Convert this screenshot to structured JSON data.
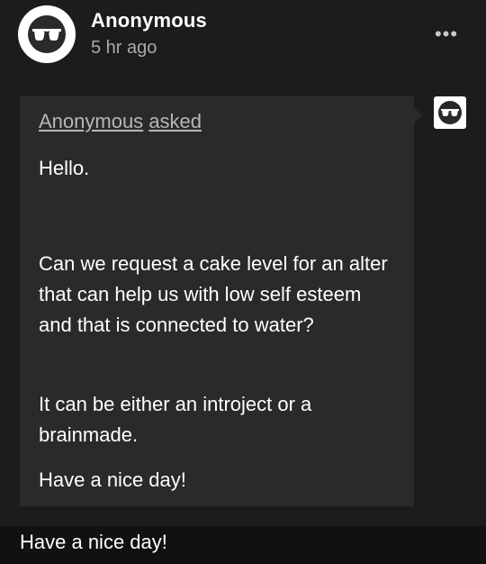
{
  "post": {
    "author": "Anonymous",
    "time": "5 hr ago",
    "more_label": "•••"
  },
  "ask": {
    "asker": "Anonymous",
    "verb": "asked",
    "paragraphs": [
      "Hello.",
      "Can we request a cake level for an alter that can help us with low self esteem and that is connected to water?",
      "It can be either an introject or a brainmade.",
      "Have a nice day!"
    ]
  },
  "answer": {
    "text": "Have a nice day!"
  },
  "icons": {
    "avatar": "anonymous-sunglasses-icon",
    "more": "more-options-icon"
  },
  "colors": {
    "background": "#1c1c1c",
    "ask_box": "#2a2a2a",
    "secondary_text": "#a9a9a9"
  }
}
